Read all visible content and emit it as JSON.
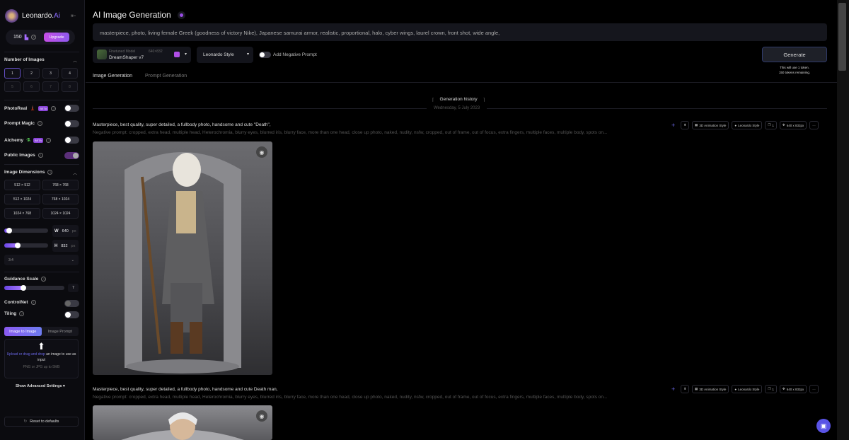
{
  "sidebar": {
    "brand": "Leonardo.",
    "brand_ai": "Ai",
    "tokens": "150",
    "upgrade": "Upgrade",
    "num_images": {
      "label": "Number of Images",
      "options": [
        "1",
        "2",
        "3",
        "4",
        "5",
        "6",
        "7",
        "8"
      ],
      "selected": "1"
    },
    "photoreal": {
      "label": "PhotoReal",
      "badge": "BETA",
      "on": false
    },
    "prompt_magic": {
      "label": "Prompt Magic",
      "on": false
    },
    "alchemy": {
      "label": "Alchemy",
      "badge": "BETA",
      "on": false
    },
    "public_images": {
      "label": "Public Images",
      "on": true
    },
    "dimensions": {
      "label": "Image Dimensions",
      "options": [
        "512 × 512",
        "768 × 768",
        "512 × 1024",
        "768 × 1024",
        "1024 × 768",
        "1024 × 1024"
      ],
      "w_label": "W",
      "w": "640",
      "h_label": "H",
      "h": "832",
      "unit": "px",
      "w_fraction": 0.05,
      "h_fraction": 0.27,
      "aspect": "3:4"
    },
    "guidance": {
      "label": "Guidance Scale",
      "value": "7",
      "fraction": 0.32
    },
    "controlnet": {
      "label": "ControlNet",
      "on": false
    },
    "tiling": {
      "label": "Tiling",
      "on": false
    },
    "img_tabs": [
      "Image to Image",
      "Image Prompt"
    ],
    "upload": {
      "link": "Upload or drag and drop",
      "rest": " an image to use as input",
      "hint": "PNG or JPG up to 5MB"
    },
    "advanced": "Show Advanced Settings",
    "reset": "Reset to defaults"
  },
  "main": {
    "title": "AI Image Generation",
    "prompt": "masterpiece, photo, living female Greek (goodness of victory Nike), Japanese samurai armor, realistic, proportional, halo, cyber wings, laurel crown, front shot, wide angle,",
    "model": {
      "caption": "Finetuned Model",
      "dims": "640×832",
      "name": "DreamShaper v7"
    },
    "style": "Leonardo Style",
    "negative_prompt_label": "Add Negative Prompt",
    "generate": "Generate",
    "gen_info": [
      "This will use 1 token.",
      "150 tokens remaining."
    ],
    "tabs": [
      "Image Generation",
      "Prompt Generation"
    ],
    "history": "Generation history",
    "date": "Wednesday, 5 July 2023",
    "generations": [
      {
        "prompt": "Masterpiece, best quality, super detailed, a fullbody photo, handsome and cute \"Death\",",
        "negative": "Negative prompt: cropped, extra head, multiple head, Heterochromia, blurry eyes, blurred iris, blurry face, more than one head, close up photo, naked, nudity, nsfw, cropped, out of frame, out of focus, extra fingers, multiple faces, multiple body, spots on...",
        "chips": [
          "3D Animation Style",
          "Leonardo Style",
          "1",
          "640 x 832px"
        ]
      },
      {
        "prompt": "Masterpiece, best quality, super detailed, a fullbody photo, handsome and cute Death man,",
        "negative": "Negative prompt: cropped, extra head, multiple head, Heterochromia, blurry eyes, blurred iris, blurry face, more than one head, close up photo, naked, nudity, nsfw, cropped, out of frame, out of focus, extra fingers, multiple faces, multiple body, spots on...",
        "chips": [
          "3D Animation Style",
          "Leonardo Style",
          "1",
          "640 x 832px"
        ]
      }
    ]
  }
}
